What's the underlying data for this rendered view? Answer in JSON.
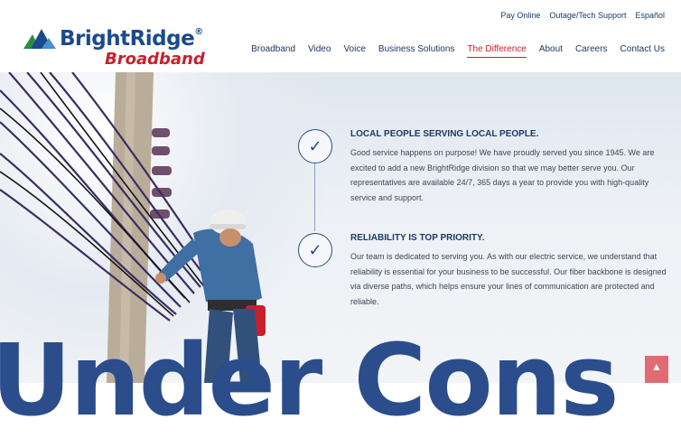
{
  "brand": {
    "name": "BrightRidge",
    "registered": "®",
    "subtitle": "Broadband",
    "colors": {
      "primary": "#1b4a8c",
      "accent": "#c8202b",
      "logo_green": "#2e8b3e"
    }
  },
  "utility_nav": [
    "Pay Online",
    "Outage/Tech Support",
    "Español"
  ],
  "main_nav": {
    "items": [
      "Broadband",
      "Video",
      "Voice",
      "Business Solutions",
      "The Difference",
      "About",
      "Careers",
      "Contact Us"
    ],
    "active": "The Difference"
  },
  "features": [
    {
      "icon": "check-icon",
      "title": "LOCAL PEOPLE SERVING LOCAL PEOPLE.",
      "text": "Good service happens on purpose! We have proudly served you since 1945. We are excited to add a new BrightRidge division so that we may better serve you. Our representatives are available 24/7, 365 days a year to provide you with high-quality service and support."
    },
    {
      "icon": "check-icon",
      "title": "RELIABILITY IS TOP PRIORITY.",
      "text": "Our team is dedicated to serving you. As with our electric service, we understand that reliability is essential for your business to be successful. Our fiber backbone is designed via diverse paths, which helps ensure your lines of communication are protected and reliable."
    }
  ],
  "overlay_text": "Under Cons",
  "scroll_top_icon": "arrow-up-icon"
}
